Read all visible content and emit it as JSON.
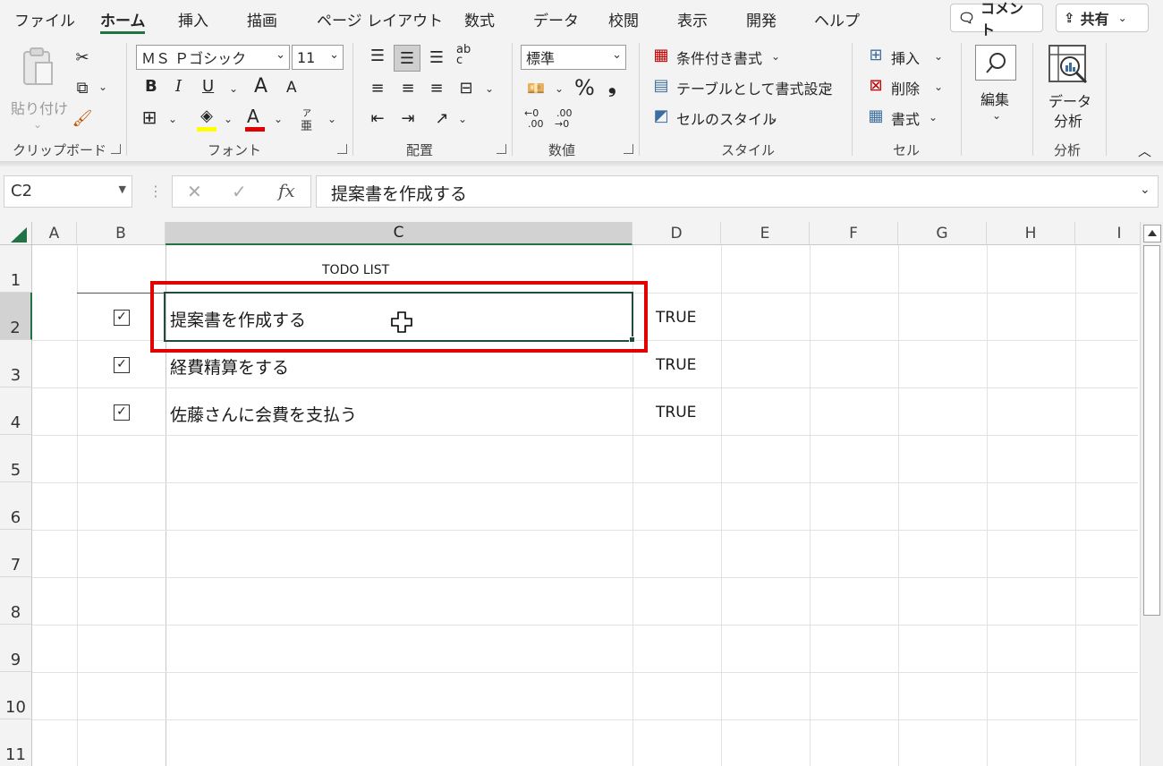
{
  "menu": {
    "tabs": [
      "ファイル",
      "ホーム",
      "挿入",
      "描画",
      "ページ レイアウト",
      "数式",
      "データ",
      "校閲",
      "表示",
      "開発",
      "ヘルプ"
    ],
    "comment_label": "コメント",
    "share_label": "共有"
  },
  "ribbon": {
    "clipboard": {
      "paste_label": "貼り付け",
      "group_label": "クリップボード"
    },
    "font": {
      "font_name": "ＭＳ Ｐゴシック",
      "font_size": "11",
      "group_label": "フォント",
      "bold": "B",
      "italic": "I",
      "underline": "U",
      "grow": "A",
      "shrink": "A",
      "font_color_letter": "A",
      "phonetic_top": "ア",
      "phonetic_bottom": "亜"
    },
    "alignment": {
      "group_label": "配置",
      "wrap_glyph": "ab c"
    },
    "number": {
      "format": "標準",
      "group_label": "数値",
      "percent": "%",
      "comma": "❟",
      "inc_decimal_top": "←0",
      "inc_decimal_bottom": ".00",
      "dec_decimal_top": ".00",
      "dec_decimal_bottom": "→0"
    },
    "styles": {
      "conditional": "条件付き書式",
      "as_table": "テーブルとして書式設定",
      "cell_styles": "セルのスタイル",
      "group_label": "スタイル"
    },
    "cells": {
      "insert": "挿入",
      "delete": "削除",
      "format": "書式",
      "group_label": "セル"
    },
    "editing": {
      "label": "編集"
    },
    "analysis": {
      "label_line1": "データ",
      "label_line2": "分析",
      "group_label": "分析"
    }
  },
  "formula_bar": {
    "name_box": "C2",
    "cancel": "✕",
    "enter": "✓",
    "fx": "fx",
    "content": "提案書を作成する"
  },
  "sheet": {
    "columns": [
      "A",
      "B",
      "C",
      "D",
      "E",
      "F",
      "G",
      "H",
      "I"
    ],
    "rows": [
      "1",
      "2",
      "3",
      "4",
      "5",
      "6",
      "7",
      "8",
      "9",
      "10",
      "11"
    ],
    "selected_cell": "C2",
    "title": "TODO LIST",
    "tasks": [
      {
        "text": "提案書を作成する",
        "checked": true,
        "value": "TRUE"
      },
      {
        "text": "経費精算をする",
        "checked": true,
        "value": "TRUE"
      },
      {
        "text": "佐藤さんに会費を支払う",
        "checked": true,
        "value": "TRUE"
      }
    ],
    "check_glyph": "✓"
  },
  "colors": {
    "accent": "#217346",
    "highlight_box": "#e30000",
    "font_color_bar": "#e00000",
    "fill_color_bar": "#ffff00"
  }
}
